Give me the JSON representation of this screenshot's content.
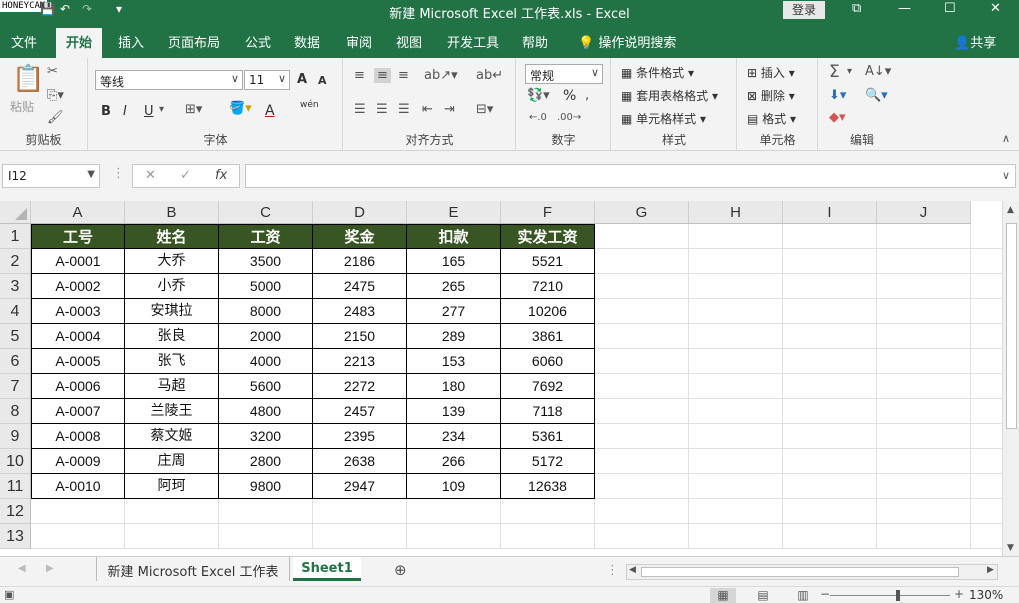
{
  "watermark": "HONEYCAM",
  "window": {
    "title": "新建 Microsoft Excel 工作表.xls  -  Excel",
    "login": "登录",
    "qat": {
      "save": "💾",
      "undo": "↶",
      "redo": "↷",
      "customize": "▾"
    },
    "controls": {
      "ribbon_display": "⧉",
      "minimize": "—",
      "maximize": "☐",
      "close": "✕"
    }
  },
  "tabs": [
    "文件",
    "开始",
    "插入",
    "页面布局",
    "公式",
    "数据",
    "审阅",
    "视图",
    "开发工具",
    "帮助"
  ],
  "active_tab": "开始",
  "tell_me": "操作说明搜索",
  "share": "共享",
  "ribbon": {
    "clipboard": {
      "label": "剪贴板",
      "paste": "粘贴"
    },
    "font": {
      "label": "字体",
      "font_name": "等线",
      "font_size": "11",
      "bold": "B",
      "italic": "I",
      "underline": "U",
      "grow": "A",
      "shrink": "A",
      "font_color": "A",
      "phonetic": "wén"
    },
    "alignment": {
      "label": "对齐方式"
    },
    "number": {
      "label": "数字",
      "format": "常规",
      "percent": "%"
    },
    "styles": {
      "label": "样式",
      "conditional": "条件格式",
      "table_format": "套用表格格式",
      "cell_styles": "单元格样式"
    },
    "cells": {
      "label": "单元格",
      "insert": "插入",
      "delete": "删除",
      "format": "格式"
    },
    "editing": {
      "label": "编辑"
    }
  },
  "formula_bar": {
    "name_box": "I12",
    "cancel": "✕",
    "enter": "✓",
    "fx": "fx",
    "formula": ""
  },
  "columns": [
    "A",
    "B",
    "C",
    "D",
    "E",
    "F",
    "G",
    "H",
    "I",
    "J"
  ],
  "rows": [
    "1",
    "2",
    "3",
    "4",
    "5",
    "6",
    "7",
    "8",
    "9",
    "10",
    "11",
    "12",
    "13"
  ],
  "table": {
    "headers": [
      "工号",
      "姓名",
      "工资",
      "奖金",
      "扣款",
      "实发工资"
    ],
    "header_color": "#375623",
    "rows": [
      [
        "A-0001",
        "大乔",
        "3500",
        "2186",
        "165",
        "5521"
      ],
      [
        "A-0002",
        "小乔",
        "5000",
        "2475",
        "265",
        "7210"
      ],
      [
        "A-0003",
        "安琪拉",
        "8000",
        "2483",
        "277",
        "10206"
      ],
      [
        "A-0004",
        "张良",
        "2000",
        "2150",
        "289",
        "3861"
      ],
      [
        "A-0005",
        "张飞",
        "4000",
        "2213",
        "153",
        "6060"
      ],
      [
        "A-0006",
        "马超",
        "5600",
        "2272",
        "180",
        "7692"
      ],
      [
        "A-0007",
        "兰陵王",
        "4800",
        "2457",
        "139",
        "7118"
      ],
      [
        "A-0008",
        "蔡文姬",
        "3200",
        "2395",
        "234",
        "5361"
      ],
      [
        "A-0009",
        "庄周",
        "2800",
        "2638",
        "266",
        "5172"
      ],
      [
        "A-0010",
        "阿珂",
        "9800",
        "2947",
        "109",
        "12638"
      ]
    ]
  },
  "sheets": [
    "新建 Microsoft Excel 工作表",
    "Sheet1"
  ],
  "active_sheet": "Sheet1",
  "status": {
    "zoom": "130%"
  },
  "accent": "#217346"
}
